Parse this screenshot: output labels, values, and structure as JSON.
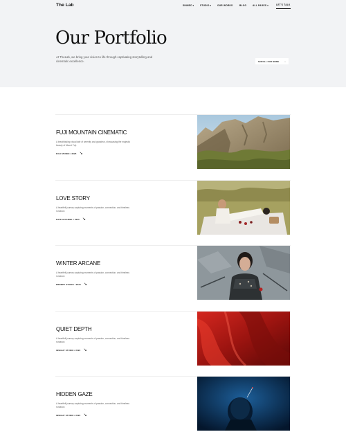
{
  "header": {
    "logo": "The Lab",
    "nav": [
      {
        "label": "SINNEC",
        "dropdown": true
      },
      {
        "label": "STUDIO",
        "dropdown": true
      },
      {
        "label": "OUR WORKS",
        "dropdown": false
      },
      {
        "label": "BLOG",
        "dropdown": false
      },
      {
        "label": "ALL PAGES",
        "dropdown": true
      }
    ],
    "cta": "LET'S TALK"
  },
  "hero": {
    "title": "Our Portfolio",
    "intro": "At TheLab, we bring your vision to life through captivating storytelling and cinematic excellence.",
    "scroll_button": "SCROLL FOR MORE",
    "scroll_arrow": "↓"
  },
  "projects": [
    {
      "name": "FUJI MOUNTAIN CINEMATIC",
      "desc": "A breathtaking visual tale of serenity and grandeur, showcasing the majestic beauty of Mount Fuji.",
      "meta": "FUJI STUDIO / 2025",
      "image": "mountain"
    },
    {
      "name": "LOVE STORY",
      "desc": "A heartfelt journey capturing moments of passion, connection, and timeless romance.",
      "meta": "KATE & DANIEL / 2025",
      "image": "picnic"
    },
    {
      "name": "WINTER ARCANE",
      "desc": "A heartfelt journey capturing moments of passion, connection, and timeless romance.",
      "meta": "PROMPT STUDIO / 2020",
      "image": "portrait"
    },
    {
      "name": "QUIET DEPTH",
      "desc": "A heartfelt journey capturing moments of passion, connection, and timeless romance.",
      "meta": "INSIGHT STUDIO / 2022",
      "image": "red"
    },
    {
      "name": "HIDDEN GAZE",
      "desc": "A heartfelt journey capturing moments of passion, connection, and timeless romance.",
      "meta": "INSIGHT STUDIO / 2022",
      "image": "blue"
    }
  ]
}
